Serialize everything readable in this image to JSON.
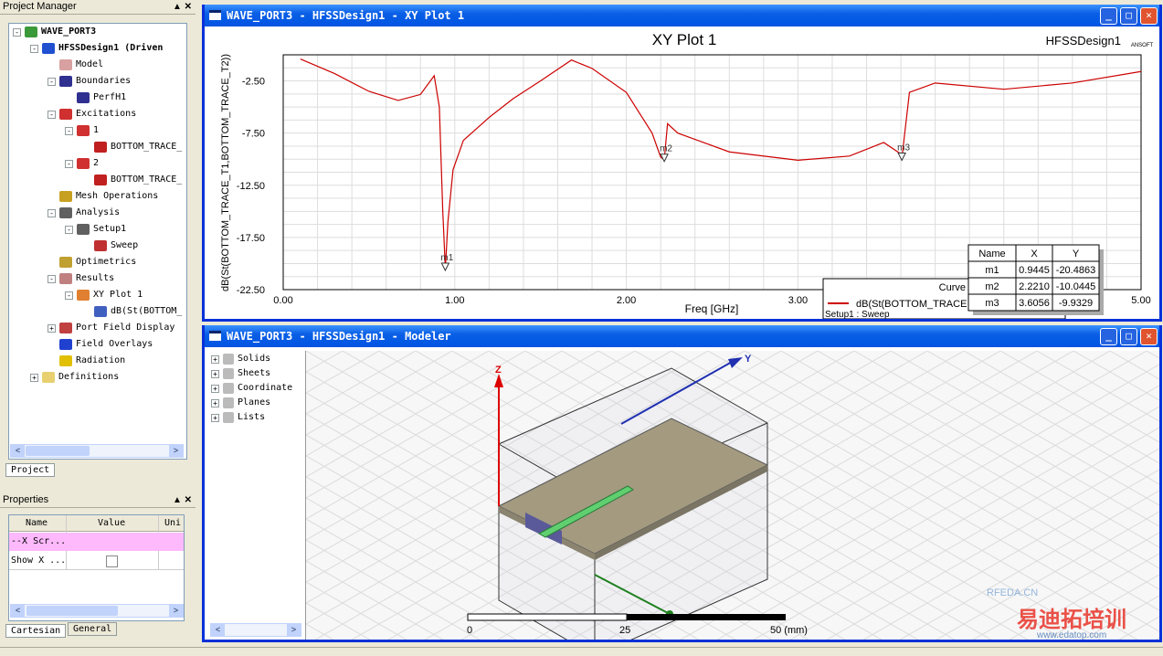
{
  "project_manager": {
    "title": "Project Manager",
    "controls": "▲ ✕",
    "tab": "Project",
    "tree": [
      {
        "label": "WAVE_PORT3",
        "level": 0,
        "exp": "-",
        "icon": "project-icon",
        "color": "#3a9a3a",
        "bold": true
      },
      {
        "label": "HFSSDesign1 (Driven",
        "level": 1,
        "exp": "-",
        "icon": "design-icon",
        "color": "#2050d0",
        "bold": true
      },
      {
        "label": "Model",
        "level": 2,
        "exp": "",
        "icon": "model-icon",
        "color": "#d8a0a0"
      },
      {
        "label": "Boundaries",
        "level": 2,
        "exp": "-",
        "icon": "boundaries-icon",
        "color": "#303090"
      },
      {
        "label": "PerfH1",
        "level": 3,
        "exp": "",
        "icon": "boundary-icon",
        "color": "#303090"
      },
      {
        "label": "Excitations",
        "level": 2,
        "exp": "-",
        "icon": "excitations-icon",
        "color": "#d03030"
      },
      {
        "label": "1",
        "level": 3,
        "exp": "-",
        "icon": "port-icon",
        "color": "#d03030"
      },
      {
        "label": "BOTTOM_TRACE_",
        "level": 4,
        "exp": "",
        "icon": "terminal-icon",
        "color": "#c02020"
      },
      {
        "label": "2",
        "level": 3,
        "exp": "-",
        "icon": "port-icon",
        "color": "#d03030"
      },
      {
        "label": "BOTTOM_TRACE_",
        "level": 4,
        "exp": "",
        "icon": "terminal-icon",
        "color": "#c02020"
      },
      {
        "label": "Mesh Operations",
        "level": 2,
        "exp": "",
        "icon": "mesh-icon",
        "color": "#c8a020"
      },
      {
        "label": "Analysis",
        "level": 2,
        "exp": "-",
        "icon": "analysis-icon",
        "color": "#606060"
      },
      {
        "label": "Setup1",
        "level": 3,
        "exp": "-",
        "icon": "setup-icon",
        "color": "#606060"
      },
      {
        "label": "Sweep",
        "level": 4,
        "exp": "",
        "icon": "sweep-icon",
        "color": "#c03030"
      },
      {
        "label": "Optimetrics",
        "level": 2,
        "exp": "",
        "icon": "optimetrics-icon",
        "color": "#c0a030"
      },
      {
        "label": "Results",
        "level": 2,
        "exp": "-",
        "icon": "results-icon",
        "color": "#c08080"
      },
      {
        "label": "XY Plot 1",
        "level": 3,
        "exp": "-",
        "icon": "xy-plot-icon",
        "color": "#e08030"
      },
      {
        "label": "dB(St(BOTTOM_",
        "level": 4,
        "exp": "",
        "icon": "trace-icon",
        "color": "#4060c0"
      },
      {
        "label": "Port Field Display",
        "level": 2,
        "exp": "+",
        "icon": "port-field-icon",
        "color": "#c04040"
      },
      {
        "label": "Field Overlays",
        "level": 2,
        "exp": "",
        "icon": "field-overlays-icon",
        "color": "#2040d0"
      },
      {
        "label": "Radiation",
        "level": 2,
        "exp": "",
        "icon": "radiation-icon",
        "color": "#e0c000"
      },
      {
        "label": "Definitions",
        "level": 1,
        "exp": "+",
        "icon": "folder-icon",
        "color": "#e8d070"
      }
    ]
  },
  "properties": {
    "title": "Properties",
    "controls": "▲ ✕",
    "columns": [
      "Name",
      "Value",
      "Uni"
    ],
    "rows": [
      {
        "name": "--X Scr...",
        "value": ""
      },
      {
        "name": "Show X ...",
        "value": "checkbox-unchecked"
      }
    ],
    "tabs": [
      "Cartesian",
      "General"
    ]
  },
  "xy_window": {
    "title": "WAVE_PORT3 - HFSSDesign1 - XY Plot 1"
  },
  "modeler_window": {
    "title": "WAVE_PORT3 - HFSSDesign1 - Modeler",
    "tree": [
      "Solids",
      "Sheets",
      "Coordinate",
      "Planes",
      "Lists"
    ],
    "axes": {
      "z": "Z",
      "y": "Y"
    },
    "scale": {
      "labels": [
        "0",
        "25",
        "50 (mm)"
      ]
    }
  },
  "chart_data": {
    "type": "line",
    "title": "XY Plot 1",
    "design_label": "HFSSDesign1",
    "logo": "ANSOFT",
    "xlabel": "Freq [GHz]",
    "ylabel": "dB(St(BOTTOM_TRACE_T1,BOTTOM_TRACE_T2))",
    "xlim": [
      0,
      5
    ],
    "ylim": [
      -22.5,
      0
    ],
    "xticks": [
      "0.00",
      "1.00",
      "2.00",
      "3.00",
      "5.00"
    ],
    "yticks": [
      "-2.50",
      "-7.50",
      "-12.50",
      "-17.50",
      "-22.50"
    ],
    "grid": true,
    "color": "#cc0000",
    "legend": {
      "header": "Curve",
      "entry": "dB(St(BOTTOM_TRACE",
      "sub": "Setup1 : Sweep",
      "placement": "bottom-right"
    },
    "series": [
      {
        "x": [
          0.1,
          0.3,
          0.5,
          0.67,
          0.8,
          0.88,
          0.91,
          0.93,
          0.945,
          0.96,
          0.99,
          1.05,
          1.2,
          1.34,
          1.5,
          1.68,
          1.8,
          2.0,
          2.15,
          2.2,
          2.221,
          2.24,
          2.3,
          2.6,
          3.0,
          3.3,
          3.5,
          3.6,
          3.6056,
          3.65,
          3.8,
          4.2,
          4.6,
          5.0
        ],
        "y": [
          -0.4,
          -1.8,
          -3.5,
          -4.37,
          -3.8,
          -2.0,
          -5,
          -15,
          -20.49,
          -16,
          -11,
          -8.2,
          -6,
          -4.2,
          -2.5,
          -0.5,
          -1.3,
          -3.6,
          -7.5,
          -9.8,
          -10.04,
          -6.6,
          -7.5,
          -9.3,
          -10.1,
          -9.7,
          -8.4,
          -9.5,
          -9.93,
          -3.6,
          -2.7,
          -3.3,
          -2.7,
          -1.6
        ]
      }
    ],
    "markers": {
      "columns": [
        "Name",
        "X",
        "Y"
      ],
      "rows": [
        [
          "m1",
          "0.9445",
          "-20.4863"
        ],
        [
          "m2",
          "2.2210",
          "-10.0445"
        ],
        [
          "m3",
          "3.6056",
          "-9.9329"
        ]
      ]
    }
  },
  "watermark": {
    "text": "易迪拓培训",
    "sub": "RFEDA.CN",
    "url": "www.edatop.com"
  }
}
